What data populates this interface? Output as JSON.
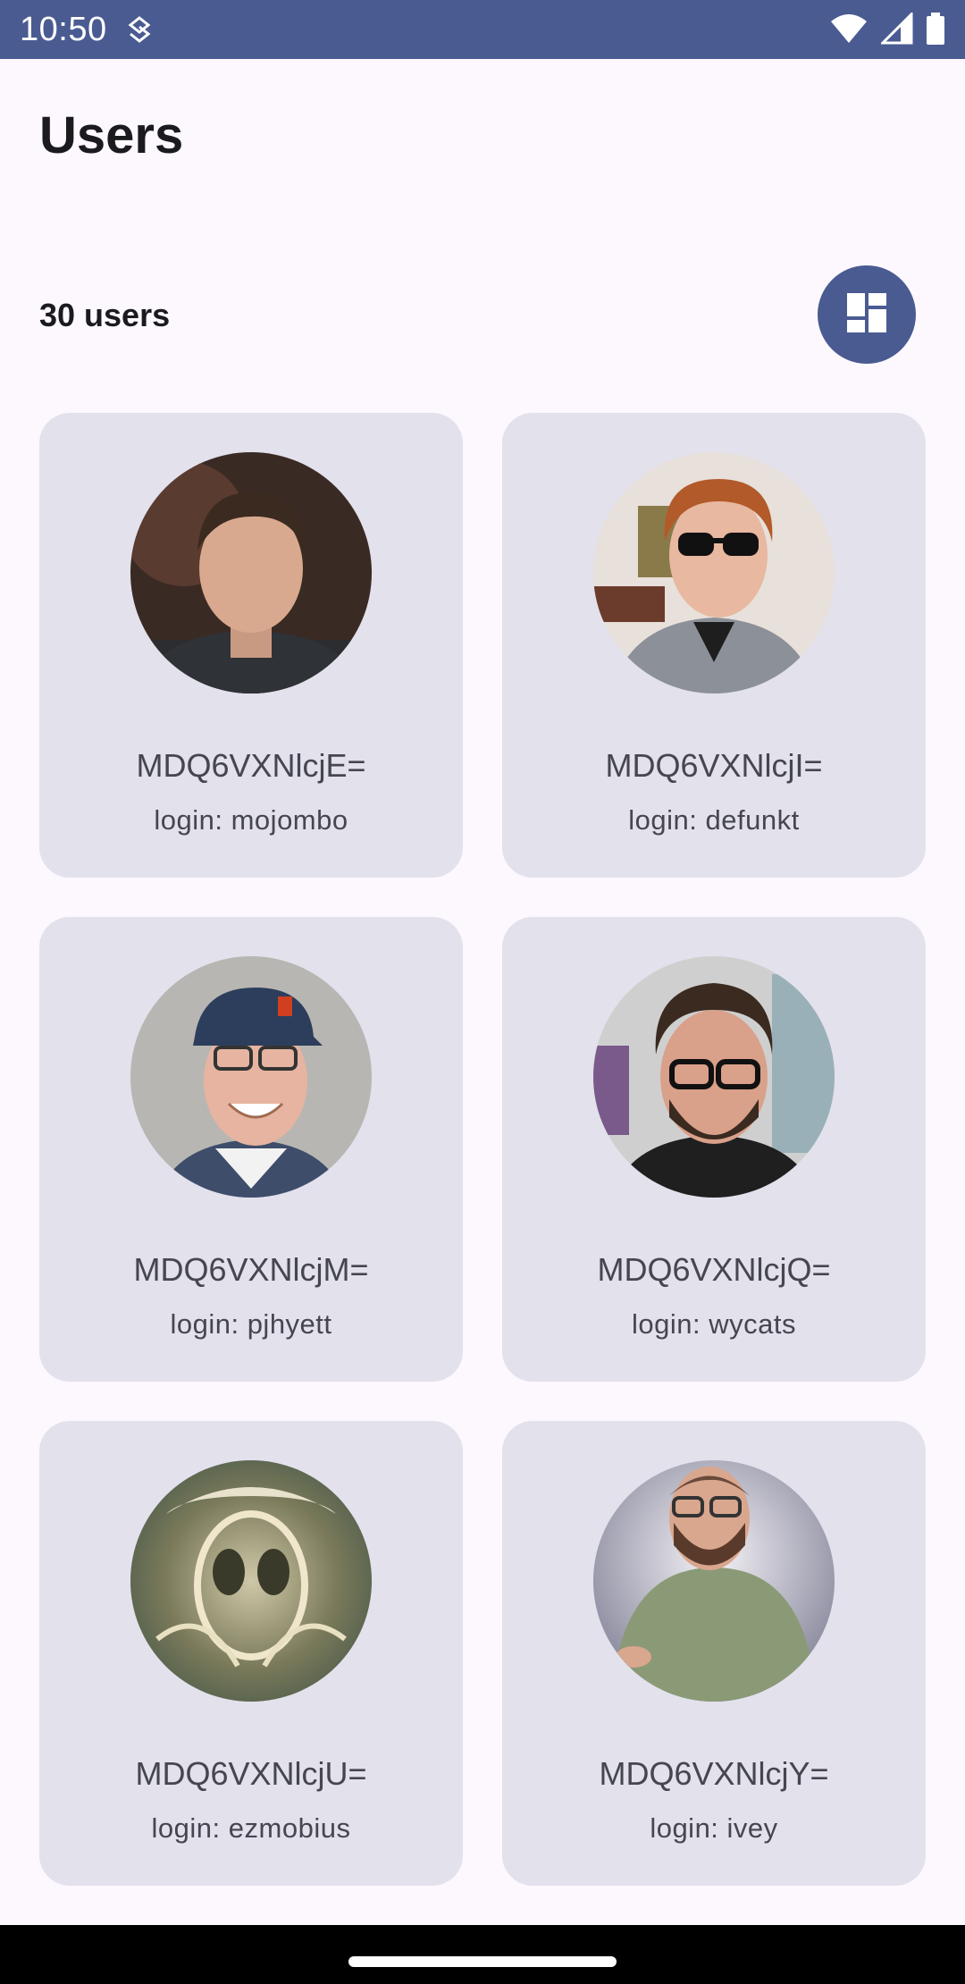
{
  "status_bar": {
    "time": "10:50",
    "icons": [
      "nfc-icon",
      "wifi-icon",
      "signal-icon",
      "battery-icon"
    ],
    "background": "#4a5b92"
  },
  "header": {
    "title": "Users"
  },
  "summary": {
    "count_label": "30 users",
    "toggle_icon": "dashboard-grid-icon",
    "accent": "#4a5b92"
  },
  "users": [
    {
      "name": "MDQ6VXNlcjE=",
      "login": "login: mojombo",
      "avatar": "portrait-photo"
    },
    {
      "name": "MDQ6VXNlcjI=",
      "login": "login: defunkt",
      "avatar": "portrait-photo"
    },
    {
      "name": "MDQ6VXNlcjM=",
      "login": "login: pjhyett",
      "avatar": "portrait-photo"
    },
    {
      "name": "MDQ6VXNlcjQ=",
      "login": "login: wycats",
      "avatar": "portrait-photo"
    },
    {
      "name": "MDQ6VXNlcjU=",
      "login": "login: ezmobius",
      "avatar": "artwork"
    },
    {
      "name": "MDQ6VXNlcjY=",
      "login": "login: ivey",
      "avatar": "portrait-photo"
    }
  ]
}
